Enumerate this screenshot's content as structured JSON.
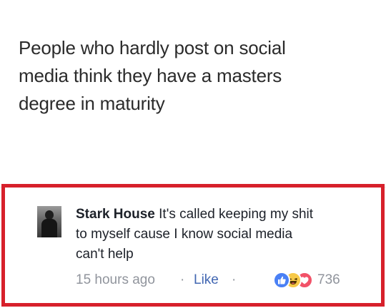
{
  "post": {
    "lines": [
      "People who hardly post on social",
      "media think they have a masters",
      "degree in maturity"
    ]
  },
  "comment": {
    "author": "Stark House",
    "text_line1": " It's called keeping my shit",
    "text_line2": "to myself cause I know social media",
    "text_line3": "can't help",
    "timestamp": "15 hours ago",
    "separator": "·",
    "like_label": "Like",
    "reactions": {
      "icons": [
        "like-icon",
        "haha-icon",
        "love-icon"
      ],
      "count": "736"
    }
  },
  "colors": {
    "highlight_border": "#d7202b",
    "link": "#4267b2",
    "meta_text": "#90949c",
    "like_reaction": "#4a80f5",
    "haha_reaction": "#f7c948",
    "love_reaction": "#f25268"
  }
}
